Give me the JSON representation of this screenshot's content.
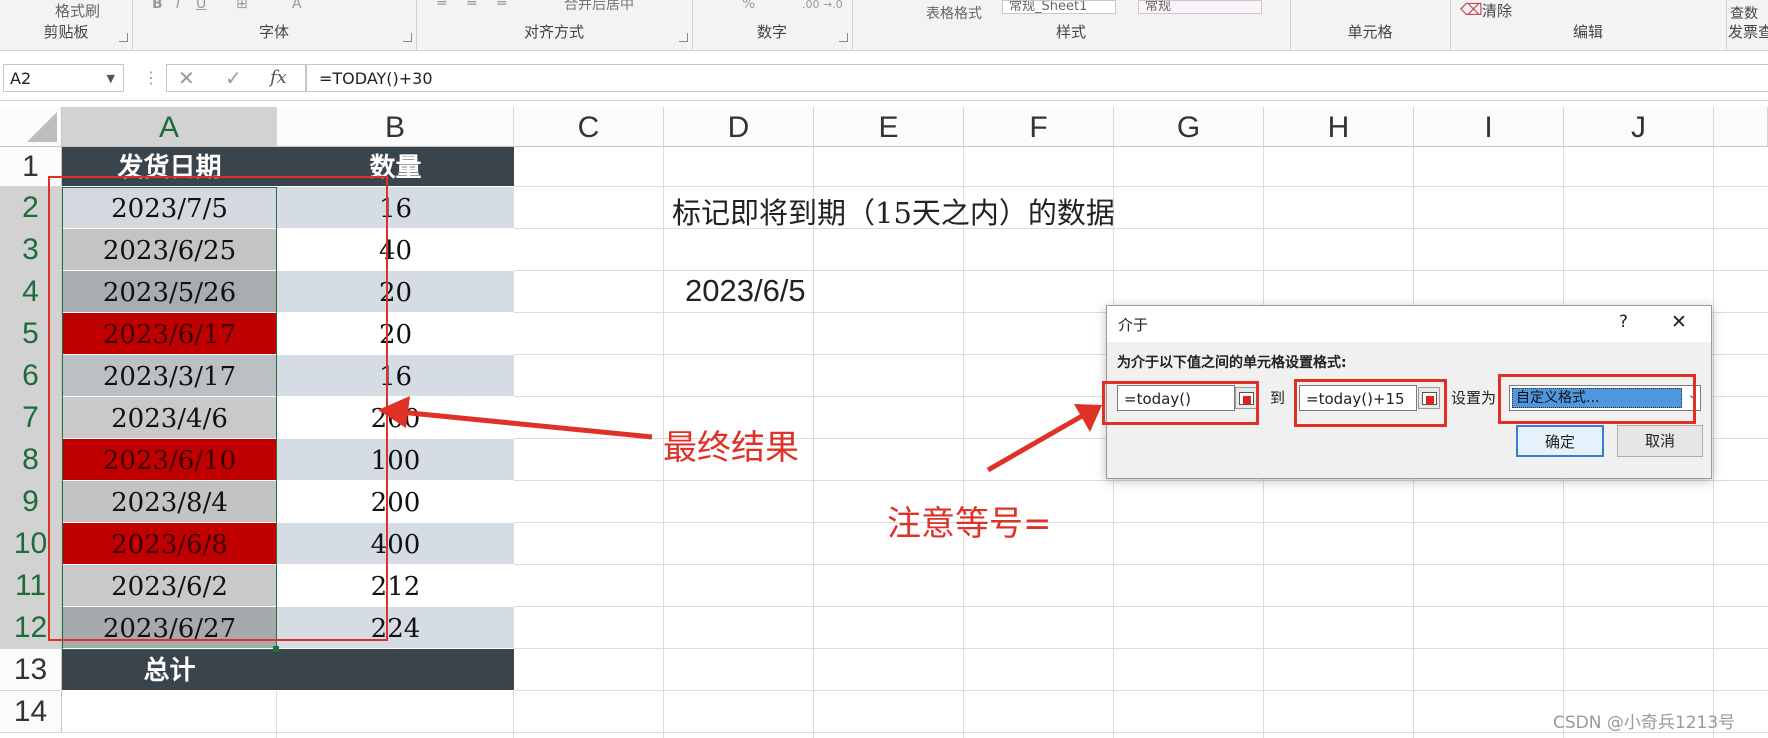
{
  "ribbon": {
    "top_fragments": {
      "format_painter": "格式刷",
      "merge_center": "合并后居中",
      "table_format": "表格格式",
      "style_box_1": "常规_Sheet1",
      "style_box_2": "常规",
      "clear": "清除",
      "partial_right": "查数"
    },
    "groups": {
      "clipboard": "剪贴板",
      "font": "字体",
      "alignment": "对齐方式",
      "number": "数字",
      "styles": "样式",
      "cells": "单元格",
      "editing": "编辑",
      "invoice": "发票查"
    }
  },
  "formula_bar": {
    "name_box": "A2",
    "fx": "fx",
    "formula": "=TODAY()+30"
  },
  "sheet": {
    "columns": [
      "A",
      "B",
      "C",
      "D",
      "E",
      "F",
      "G",
      "H",
      "I",
      "J"
    ],
    "rows": [
      "1",
      "2",
      "3",
      "4",
      "5",
      "6",
      "7",
      "8",
      "9",
      "10",
      "11",
      "12",
      "13",
      "14"
    ],
    "header_date": "发货日期",
    "header_qty": "数量",
    "data": [
      {
        "date": "2023/7/5",
        "qty": "16",
        "highlight": false
      },
      {
        "date": "2023/6/25",
        "qty": "40",
        "highlight": false
      },
      {
        "date": "2023/5/26",
        "qty": "20",
        "highlight": false
      },
      {
        "date": "2023/6/17",
        "qty": "20",
        "highlight": true
      },
      {
        "date": "2023/3/17",
        "qty": "16",
        "highlight": false
      },
      {
        "date": "2023/4/6",
        "qty": "200",
        "highlight": false
      },
      {
        "date": "2023/6/10",
        "qty": "100",
        "highlight": true
      },
      {
        "date": "2023/8/4",
        "qty": "200",
        "highlight": false
      },
      {
        "date": "2023/6/8",
        "qty": "400",
        "highlight": true
      },
      {
        "date": "2023/6/2",
        "qty": "212",
        "highlight": false
      },
      {
        "date": "2023/6/27",
        "qty": "224",
        "highlight": false
      }
    ],
    "total_label": "总计",
    "d2_text": "标记即将到期（15天之内）的数据",
    "d4_value": "2023/6/5"
  },
  "annotations": {
    "final_result": "最终结果",
    "note_equal": "注意等号="
  },
  "dialog": {
    "title": "介于",
    "help": "?",
    "close": "✕",
    "prompt": "为介于以下值之间的单元格设置格式:",
    "from_value": "=today()",
    "to_label": "到",
    "to_value": "=today()+15",
    "set_as_label": "设置为",
    "format_value": "自定义格式...",
    "ok": "确定",
    "cancel": "取消"
  },
  "watermark": "CSDN @小奇兵1213号",
  "colors": {
    "header_dark": "#3a444c",
    "highlight_red": "#c00000",
    "band_light": "#d6dce4",
    "band_gray": "#bfbfbf",
    "annotation_red": "#e03127",
    "selection_green": "#1e7145"
  }
}
